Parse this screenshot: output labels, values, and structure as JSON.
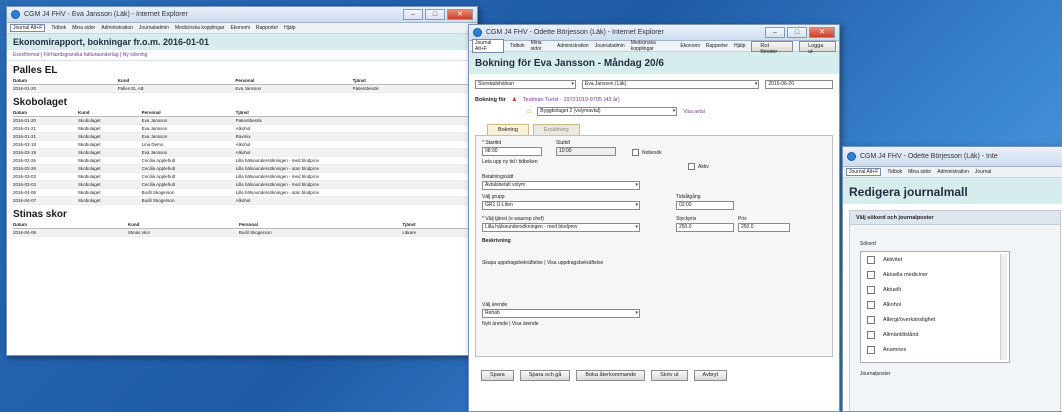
{
  "w1": {
    "title": "CGM J4 FHV - Eva Jansson (Läk) - Internet Explorer",
    "menu": [
      "Journal Alt+F",
      "Tidbok",
      "Mina sidor",
      "Administration",
      "Journaladmin",
      "Medicinska kopplingar",
      "Ekonomi",
      "Rapporter",
      "Hjälp"
    ],
    "header": "Ekonomirapport, bokningar fr.o.m. 2016-01-01",
    "subtitle": "Excelformat | Förhandsgranska fakturaunderlag | Ny sökning",
    "cols": [
      "Datum",
      "Kund",
      "Personal",
      "Tjänst"
    ],
    "sections": [
      {
        "name": "Palles EL",
        "rows": [
          [
            "2016-01-20",
            "Palles EL AB",
            "Eva Jansson",
            "Patientbesök"
          ]
        ]
      },
      {
        "name": "Skobolaget",
        "rows": [
          [
            "2016-01-20",
            "Skobolaget",
            "Eva Jansson",
            "Patientbesök"
          ],
          [
            "2016-01-21",
            "Skobolaget",
            "Eva Jansson",
            "Alkohol"
          ],
          [
            "2016-01-21",
            "Skobolaget",
            "Eva Jansson",
            "Ravmix"
          ],
          [
            "2016-02-18",
            "Skobolaget",
            "Lina Demo",
            "Alkohol"
          ],
          [
            "2016-02-19",
            "Skobolaget",
            "Eva Jansson",
            "Alkohol"
          ],
          [
            "2016-02-26",
            "Skobolaget",
            "Cecilia Applehult",
            "Lilla hälsoundersökningen - med blodprov"
          ],
          [
            "2016-02-26",
            "Skobolaget",
            "Cecilia Applehult",
            "Lilla hälsoundersökningen - utan blodprov"
          ],
          [
            "2016-03-03",
            "Skobolaget",
            "Cecilia Applehult",
            "Lilla hälsoundersökningen - med blodprov"
          ],
          [
            "2016-03-03",
            "Skobolaget",
            "Cecilia Applehult",
            "Lilla hälsoundersökningen - med blodprov"
          ],
          [
            "2016-04-06",
            "Skobolaget",
            "Bodil Skogerson",
            "Lilla hälsoundersökningen - utan blodprov"
          ],
          [
            "2016-04-07",
            "Skobolaget",
            "Bodil Skogerson",
            "Alkohol"
          ]
        ]
      },
      {
        "name": "Stinas skor",
        "rows": [
          [
            "2016-04-06",
            "Stinas skor",
            "Bodil Skogerson",
            "Läkare"
          ]
        ]
      }
    ]
  },
  "w2": {
    "title": "CGM J4 FHV - Odette Börjesson (Läk) - Internet Explorer",
    "menu": [
      "Journal Alt+F",
      "Tidbok",
      "Mina sidor",
      "Administration",
      "Journaladmin",
      "Medicinska kopplingar",
      "Ekonomi",
      "Rapporter",
      "Hjälp"
    ],
    "right_buttons": [
      "Rot fönster",
      "Logga ut"
    ],
    "header": "Bokning för Eva Jansson - Måndag 20/6",
    "unit": "Storstadshälsan",
    "person": "Eva Jansson (Läk)",
    "date": "2016-06-20",
    "booking_for": "Bokning för",
    "patient": "Testman Turist - 19721019-9705 (43 år)",
    "company": "Byggbolaget 2 (volymavtal)",
    "show_agreement": "Visa avtal",
    "tabs": [
      "Bokning",
      "Ersättning"
    ],
    "start_label": "* Starttid",
    "start": "08:00",
    "end_label": "Sluttid",
    "end": "10:00",
    "find_time": "Leta upp ny tid i tidboken",
    "nobesok": "Nobesök",
    "aktiv": "Aktiv",
    "payment_label": "Betalningssätt",
    "payment": "Avtalsbetalt volym",
    "group_label": "Välj grupp",
    "group": "GR1 U-Liten",
    "time_label": "Tidsåtgång",
    "time": "02:00",
    "service_label": "* Välj tjänst (e waunsp chef)",
    "service": "Lilla hälsoundersökningen - med blodprov",
    "unitprice_label": "Styckpris",
    "unitprice": "250.0",
    "price_label": "Pris",
    "price": "250.0",
    "description_label": "Beskrivning",
    "desc_links": "Skapa uppdragsbekräftelse | Visa uppdragsbekräftelse",
    "case_label": "Välj ärende",
    "case": "Rehab",
    "case_links": "Nytt ärende | Visa ärende",
    "buttons": [
      "Spara",
      "Spara och gå",
      "Boka återkommande",
      "Skriv ut",
      "Avbryt"
    ]
  },
  "w3": {
    "title": "CGM J4 FHV - Odette Börjesson (Läk) - Inte",
    "menu": [
      "Journal Alt+F",
      "Tidbok",
      "Mina sidor",
      "Administration",
      "Journal"
    ],
    "header": "Redigera journalmall",
    "panel_title": "Välj sökord och journalposter",
    "sokord_label": "Sökord",
    "items": [
      "Aktivitet",
      "Aktuella mediciner",
      "Aktuellt",
      "Alkohol",
      "Allergi/överkänslighet",
      "Allmäntillstånd",
      "Anamnes"
    ],
    "journalposter_label": "Journalposter"
  }
}
